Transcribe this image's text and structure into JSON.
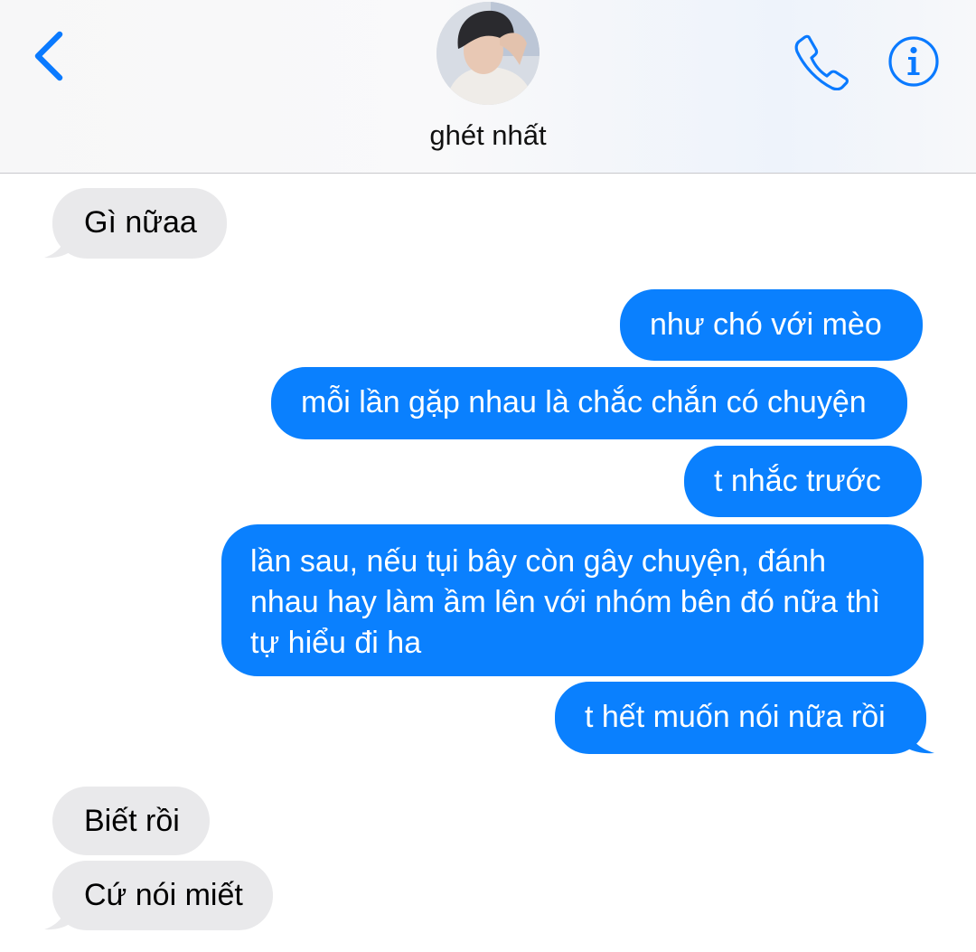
{
  "header": {
    "contact_name": "ghét nhất",
    "back_icon": "chevron-left-icon",
    "call_icon": "phone-icon",
    "info_icon": "info-icon",
    "accent_color": "#0a7aff"
  },
  "messages": [
    {
      "direction": "incoming",
      "text": "Gì nữaa"
    },
    {
      "direction": "outgoing",
      "text": "như chó với mèo"
    },
    {
      "direction": "outgoing",
      "text": "mỗi lần gặp nhau là chắc chắn có chuyện"
    },
    {
      "direction": "outgoing",
      "text": "t nhắc trước"
    },
    {
      "direction": "outgoing",
      "text": "lần sau, nếu tụi bây còn gây chuyện, đánh nhau hay làm ầm lên với nhóm bên đó nữa thì tự hiểu đi ha"
    },
    {
      "direction": "outgoing",
      "text": "t hết muốn nói nữa rồi"
    },
    {
      "direction": "incoming",
      "text": "Biết rồi"
    },
    {
      "direction": "incoming",
      "text": "Cứ nói miết"
    }
  ],
  "colors": {
    "outgoing_bubble": "#0a80fe",
    "incoming_bubble": "#e9e9eb"
  }
}
